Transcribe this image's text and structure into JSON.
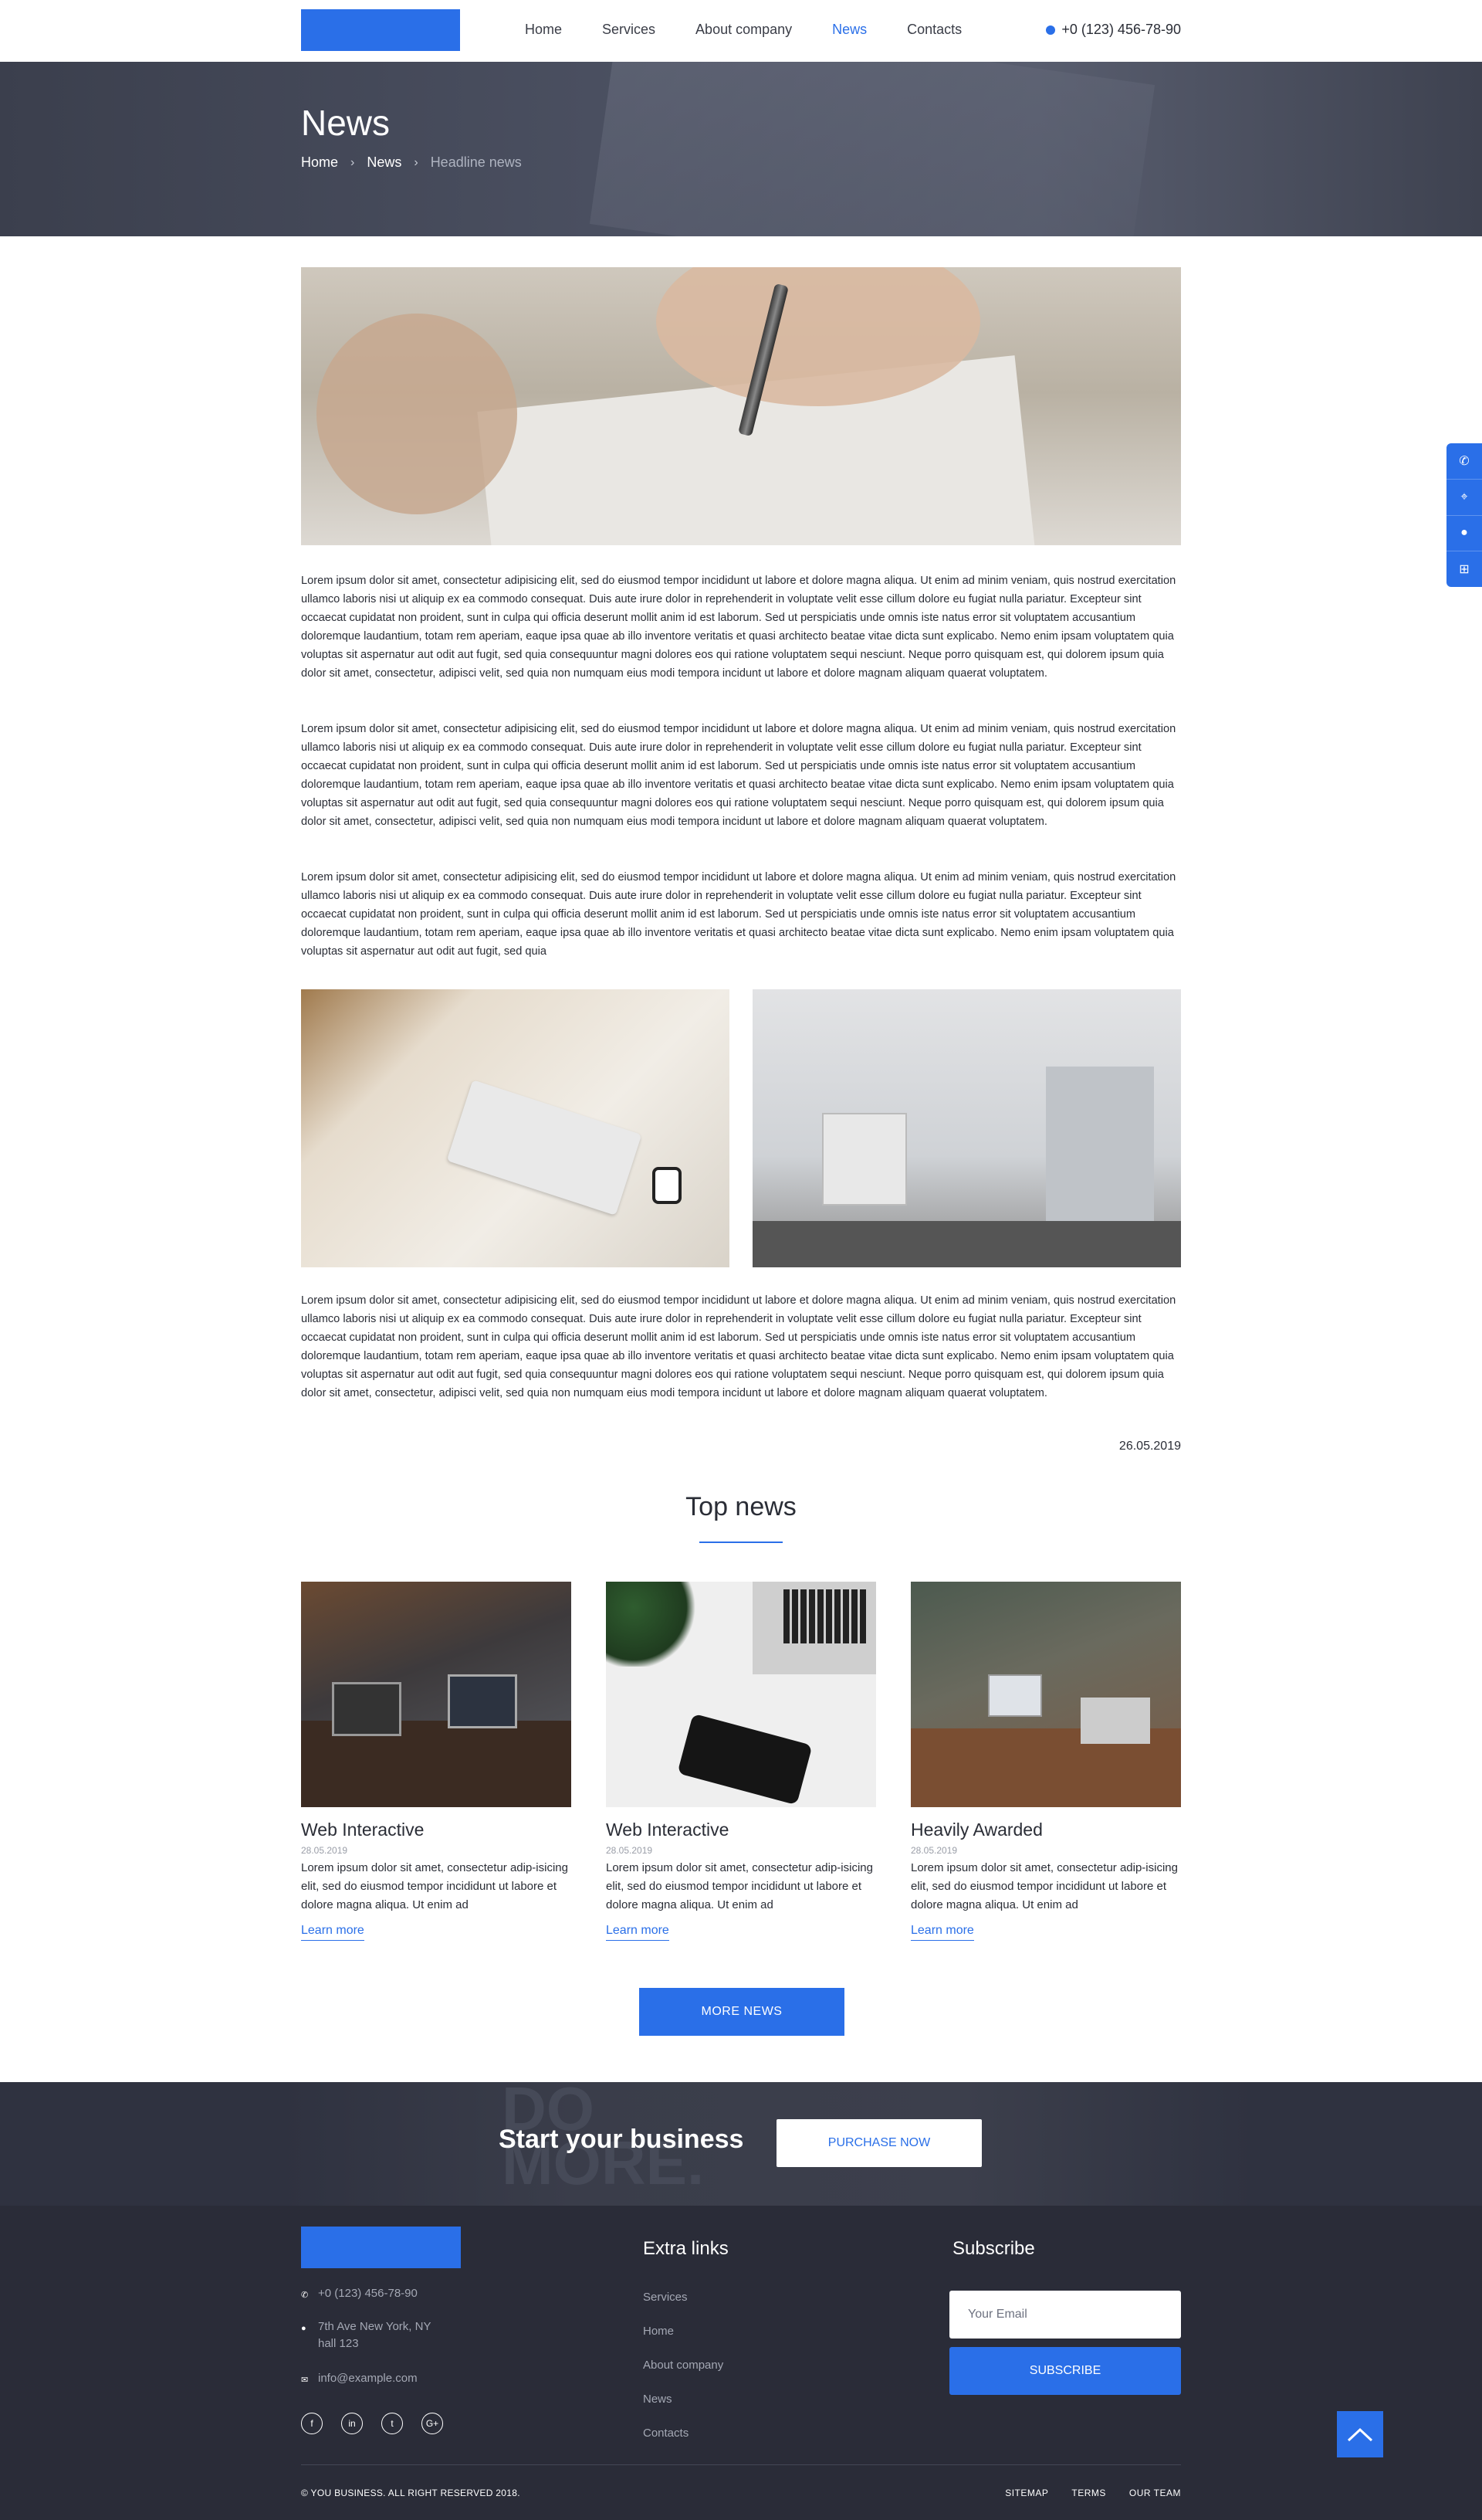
{
  "header": {
    "nav": [
      "Home",
      "Services",
      "About company",
      "News",
      "Contacts"
    ],
    "active_nav": "News",
    "phone": "+0 (123) 456-78-90"
  },
  "banner": {
    "title": "News",
    "breadcrumbs": [
      "Home",
      "News",
      "Headline news"
    ]
  },
  "article": {
    "paragraphs": [
      "Lorem ipsum dolor sit amet, consectetur adipisicing elit, sed do eiusmod tempor incididunt ut labore et dolore magna aliqua. Ut enim ad minim veniam, quis nostrud exercitation ullamco laboris nisi ut aliquip ex ea commodo consequat. Duis aute irure dolor in reprehenderit in voluptate velit esse cillum dolore eu fugiat nulla pariatur. Excepteur sint occaecat cupidatat non proident, sunt in culpa qui officia deserunt mollit anim id est laborum. Sed ut perspiciatis unde omnis iste natus error sit voluptatem accusantium doloremque laudantium, totam rem aperiam, eaque ipsa quae ab illo inventore veritatis et quasi architecto beatae vitae dicta sunt explicabo. Nemo enim ipsam voluptatem quia voluptas sit aspernatur aut odit aut fugit, sed quia consequuntur magni dolores eos qui ratione voluptatem sequi nesciunt. Neque porro quisquam est, qui dolorem ipsum quia dolor sit amet, consectetur, adipisci velit, sed quia non numquam eius modi tempora incidunt ut labore et dolore magnam aliquam quaerat voluptatem.",
      "Lorem ipsum dolor sit amet, consectetur adipisicing elit, sed do eiusmod tempor incididunt ut labore et dolore magna aliqua. Ut enim ad minim veniam, quis nostrud exercitation ullamco laboris nisi ut aliquip ex ea commodo consequat. Duis aute irure dolor in reprehenderit in voluptate velit esse cillum dolore eu fugiat nulla pariatur. Excepteur sint occaecat cupidatat non proident, sunt in culpa qui officia deserunt mollit anim id est laborum. Sed ut perspiciatis unde omnis iste natus error sit voluptatem accusantium doloremque laudantium, totam rem aperiam, eaque ipsa quae ab illo inventore veritatis et quasi architecto beatae vitae dicta sunt explicabo. Nemo enim ipsam voluptatem quia voluptas sit aspernatur aut odit aut fugit, sed quia consequuntur magni dolores eos qui ratione voluptatem sequi nesciunt. Neque porro quisquam est, qui dolorem ipsum quia dolor sit amet, consectetur, adipisci velit, sed quia non numquam eius modi tempora incidunt ut labore et dolore magnam aliquam quaerat voluptatem.",
      "Lorem ipsum dolor sit amet, consectetur adipisicing elit, sed do eiusmod tempor incididunt ut labore et dolore magna aliqua. Ut enim ad minim veniam, quis nostrud exercitation ullamco laboris nisi ut aliquip ex ea commodo consequat. Duis aute irure dolor in reprehenderit in voluptate velit esse cillum dolore eu fugiat nulla pariatur. Excepteur sint occaecat cupidatat non proident, sunt in culpa qui officia deserunt mollit anim id est laborum. Sed ut perspiciatis unde omnis iste natus error sit voluptatem accusantium doloremque laudantium, totam rem aperiam, eaque ipsa quae ab illo inventore veritatis et quasi architecto beatae vitae dicta sunt explicabo. Nemo enim ipsam voluptatem quia voluptas sit aspernatur aut odit aut fugit, sed quia",
      "Lorem ipsum dolor sit amet, consectetur adipisicing elit, sed do eiusmod tempor incididunt ut labore et dolore magna aliqua. Ut enim ad minim veniam, quis nostrud exercitation ullamco laboris nisi ut aliquip ex ea commodo consequat. Duis aute irure dolor in reprehenderit in voluptate velit esse cillum dolore eu fugiat nulla pariatur. Excepteur sint occaecat cupidatat non proident, sunt in culpa qui officia deserunt mollit anim id est laborum. Sed ut perspiciatis unde omnis iste natus error sit voluptatem accusantium doloremque laudantium, totam rem aperiam, eaque ipsa quae ab illo inventore veritatis et quasi architecto beatae vitae dicta sunt explicabo. Nemo enim ipsam voluptatem quia voluptas sit aspernatur aut odit aut fugit, sed quia consequuntur magni dolores eos qui ratione voluptatem sequi nesciunt. Neque porro quisquam est, qui dolorem ipsum quia dolor sit amet, consectetur, adipisci velit, sed quia non numquam eius modi tempora incidunt ut labore et dolore magnam aliquam quaerat voluptatem."
    ],
    "date": "26.05.2019"
  },
  "top_news": {
    "title": "Top news",
    "cards": [
      {
        "title": "Web Interactive",
        "date": "28.05.2019",
        "text": "Lorem ipsum dolor sit amet, consectetur adip-isicing elit, sed do eiusmod tempor incididunt ut labore et dolore magna aliqua. Ut enim ad",
        "link": "Learn more"
      },
      {
        "title": "Web Interactive",
        "date": "28.05.2019",
        "text": "Lorem ipsum dolor sit amet, consectetur adip-isicing elit, sed do eiusmod tempor incididunt ut labore et dolore magna aliqua. Ut enim ad",
        "link": "Learn more"
      },
      {
        "title": "Heavily Awarded",
        "date": "28.05.2019",
        "text": "Lorem ipsum dolor sit amet, consectetur adip-isicing elit, sed do eiusmod tempor incididunt ut labore et dolore magna aliqua. Ut enim ad",
        "link": "Learn more"
      }
    ],
    "more_button": "MORE NEWS"
  },
  "cta": {
    "bg_text": "DO MORE.",
    "title": "Start your business",
    "button": "PURCHASE NOW"
  },
  "footer": {
    "phone": "+0 (123) 456-78-90",
    "address_line1": "7th Ave New York, NY",
    "address_line2": "hall 123",
    "email": "info@example.com",
    "social": [
      "f",
      "in",
      "t",
      "G+"
    ],
    "extra_links_title": "Extra links",
    "extra_links": [
      "Services",
      "Home",
      "About company",
      "News",
      "Contacts"
    ],
    "subscribe_title": "Subscribe",
    "email_placeholder": "Your Email",
    "subscribe_button": "SUBSCRIBE",
    "copyright": "© YOU BUSINESS. ALL RIGHT RESERVED 2018.",
    "bottom_links": [
      "SITEMAP",
      "TERMS",
      "OUR TEAM"
    ]
  },
  "side_widget": {
    "icons": [
      "phone-icon",
      "map-pin-icon",
      "chat-icon",
      "cart-icon"
    ]
  },
  "colors": {
    "accent": "#2a6fe8",
    "footer_bg": "#2a2c38",
    "banner_bg": "#4a4f60"
  }
}
